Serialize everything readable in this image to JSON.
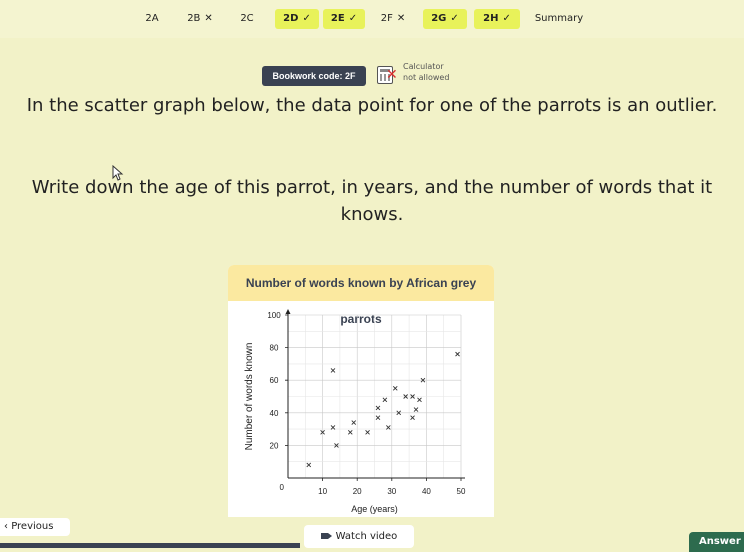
{
  "tabs": [
    {
      "label": "2A",
      "state": "none",
      "mark": ""
    },
    {
      "label": "2B",
      "state": "wrong",
      "mark": "✕"
    },
    {
      "label": "2C",
      "state": "none",
      "mark": ""
    },
    {
      "label": "2D",
      "state": "done",
      "mark": "✓"
    },
    {
      "label": "2E",
      "state": "done",
      "mark": "✓"
    },
    {
      "label": "2F",
      "state": "wrong",
      "mark": "✕"
    },
    {
      "label": "2G",
      "state": "done",
      "mark": "✓"
    },
    {
      "label": "2H",
      "state": "done",
      "mark": "✓"
    },
    {
      "label": "Summary",
      "state": "summary",
      "mark": ""
    }
  ],
  "bookwork": {
    "label": "Bookwork code: 2F"
  },
  "calculator": {
    "title": "Calculator",
    "status": "not allowed"
  },
  "question": {
    "line1": "In the scatter graph below, the data point for one of the parrots is an outlier.",
    "line2": "Write down the age of this parrot, in years, and the number of words that it knows."
  },
  "colors": {
    "done_tab": "#e8f25a",
    "card_header": "#fbe9a0",
    "dark": "#3a4252",
    "answer": "#2d6b4e"
  },
  "chart_data": {
    "type": "scatter",
    "title": "Number of words known by African grey parrots",
    "xlabel": "Age (years)",
    "ylabel": "Number of words known",
    "xlim": [
      0,
      50
    ],
    "ylim": [
      0,
      100
    ],
    "xticks": [
      10,
      20,
      30,
      40,
      50
    ],
    "yticks": [
      20,
      40,
      60,
      80,
      100
    ],
    "origin_label": "0",
    "grid": true,
    "points": [
      {
        "x": 6,
        "y": 8
      },
      {
        "x": 10,
        "y": 28
      },
      {
        "x": 13,
        "y": 31
      },
      {
        "x": 13,
        "y": 66
      },
      {
        "x": 18,
        "y": 28
      },
      {
        "x": 19,
        "y": 34
      },
      {
        "x": 14,
        "y": 20
      },
      {
        "x": 23,
        "y": 28
      },
      {
        "x": 26,
        "y": 43
      },
      {
        "x": 26,
        "y": 37
      },
      {
        "x": 28,
        "y": 48
      },
      {
        "x": 29,
        "y": 31
      },
      {
        "x": 31,
        "y": 55
      },
      {
        "x": 32,
        "y": 40
      },
      {
        "x": 34,
        "y": 50
      },
      {
        "x": 36,
        "y": 50
      },
      {
        "x": 36,
        "y": 37
      },
      {
        "x": 37,
        "y": 42
      },
      {
        "x": 38,
        "y": 48
      },
      {
        "x": 39,
        "y": 60
      },
      {
        "x": 49,
        "y": 76
      }
    ]
  },
  "footer": {
    "previous": "Previous",
    "watch_video": "Watch video",
    "answer": "Answer"
  }
}
